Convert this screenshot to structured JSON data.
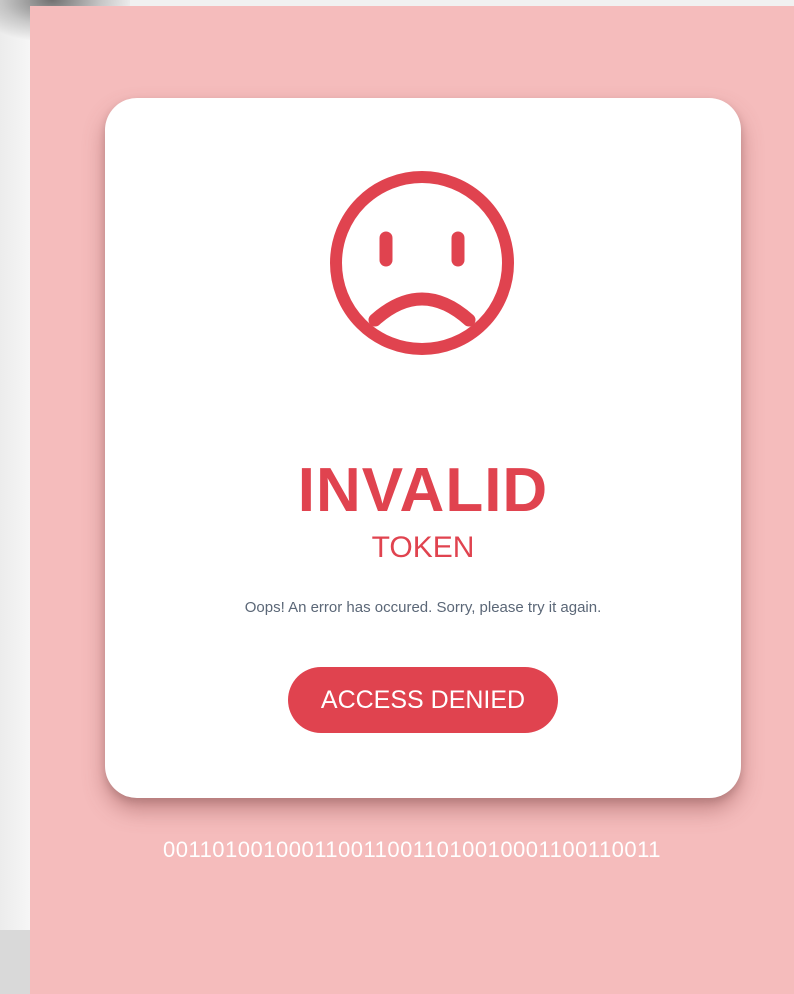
{
  "card": {
    "title": "INVALID",
    "subtitle": "TOKEN",
    "message": "Oops! An error has occured. Sorry, please try it again.",
    "button_label": "ACCESS DENIED",
    "icon": "sad-face-icon"
  },
  "footer": {
    "binary": "0011010010001100110011010010001100110011"
  },
  "colors": {
    "accent": "#e0434f",
    "background": "#f5bcbc",
    "card": "#ffffff",
    "message_text": "#5b6777"
  }
}
